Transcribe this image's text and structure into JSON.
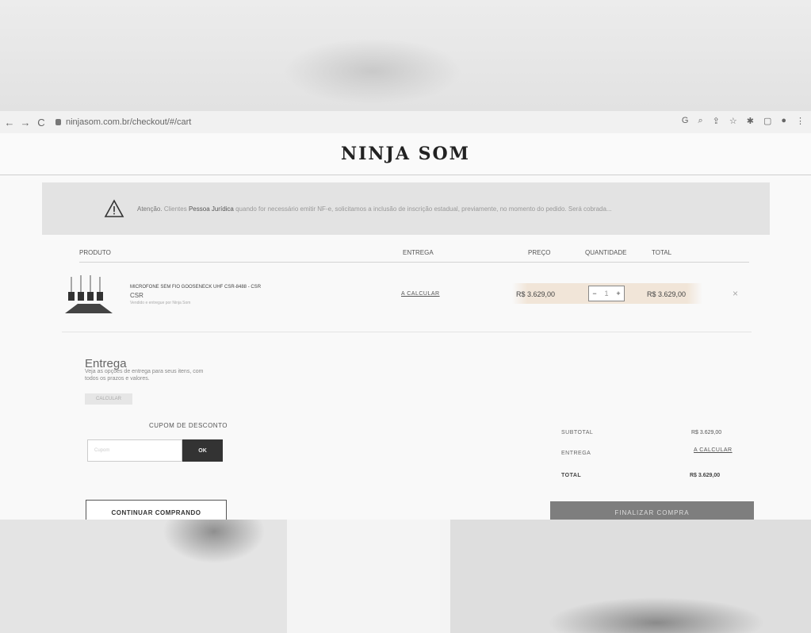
{
  "browser": {
    "url": "ninjasom.com.br/checkout/#/cart"
  },
  "header": {
    "logo": "NINJA SOM"
  },
  "alert": {
    "lead": "Atenção.",
    "text1": "Clientes",
    "bold": "Pessoa Jurídica",
    "text2": "quando for necessário emitir NF-e, solicitamos a inclusão de inscrição estadual, previamente, no momento do pedido. Será cobrada..."
  },
  "table": {
    "headers": {
      "product": "PRODUTO",
      "delivery": "ENTREGA",
      "price": "PREÇO",
      "quantity": "QUANTIDADE",
      "total": "TOTAL"
    },
    "item": {
      "name": "MICROFONE SEM FIO GOOSENECK UHF CSR-8488 - CSR",
      "sku": "CSR",
      "sub": "Vendido e entregue por Ninja Som",
      "delivery_link": "A CALCULAR",
      "price": "R$ 3.629,00",
      "qty_minus": "−",
      "qty": "1",
      "qty_plus": "+",
      "total": "R$ 3.629,00",
      "remove": "×"
    }
  },
  "shipping": {
    "title": "Entrega",
    "desc": "Veja as opções de entrega para seus itens, com todos os prazos e valores.",
    "button": "CALCULAR"
  },
  "coupon": {
    "label": "CUPOM DE DESCONTO",
    "placeholder": "Cupom",
    "button": "OK"
  },
  "continue_button": "CONTINUAR COMPRANDO",
  "summary": {
    "subtotal_label": "SUBTOTAL",
    "subtotal_value": "R$ 3.629,00",
    "delivery_label": "ENTREGA",
    "delivery_value": "A CALCULAR",
    "total_label": "TOTAL",
    "total_value": "R$ 3.629,00"
  },
  "finalize_button": "FINALIZAR COMPRA"
}
